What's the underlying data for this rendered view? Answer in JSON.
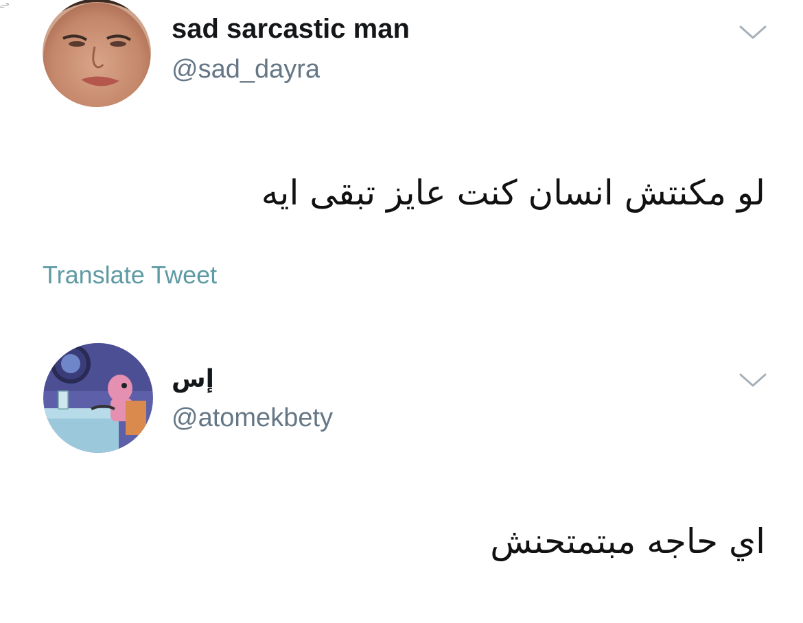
{
  "watermark": {
    "text": "ﺣﮯ"
  },
  "tweets": [
    {
      "display_name": "sad sarcastic man",
      "handle": "@sad_dayra",
      "text": "لو مكنتش انسان كنت عايز تبقى ايه",
      "translate_label": "Translate Tweet",
      "avatar_icon": "profile-photo-man"
    },
    {
      "display_name": "إس",
      "handle": "@atomekbety",
      "text": "اي حاجه مبتمتحنش",
      "avatar_icon": "cartoon-character-at-table"
    }
  ],
  "colors": {
    "name": "#14171a",
    "handle": "#657786",
    "translate": "#5e9aa3",
    "chevron": "#a7b0b8"
  }
}
